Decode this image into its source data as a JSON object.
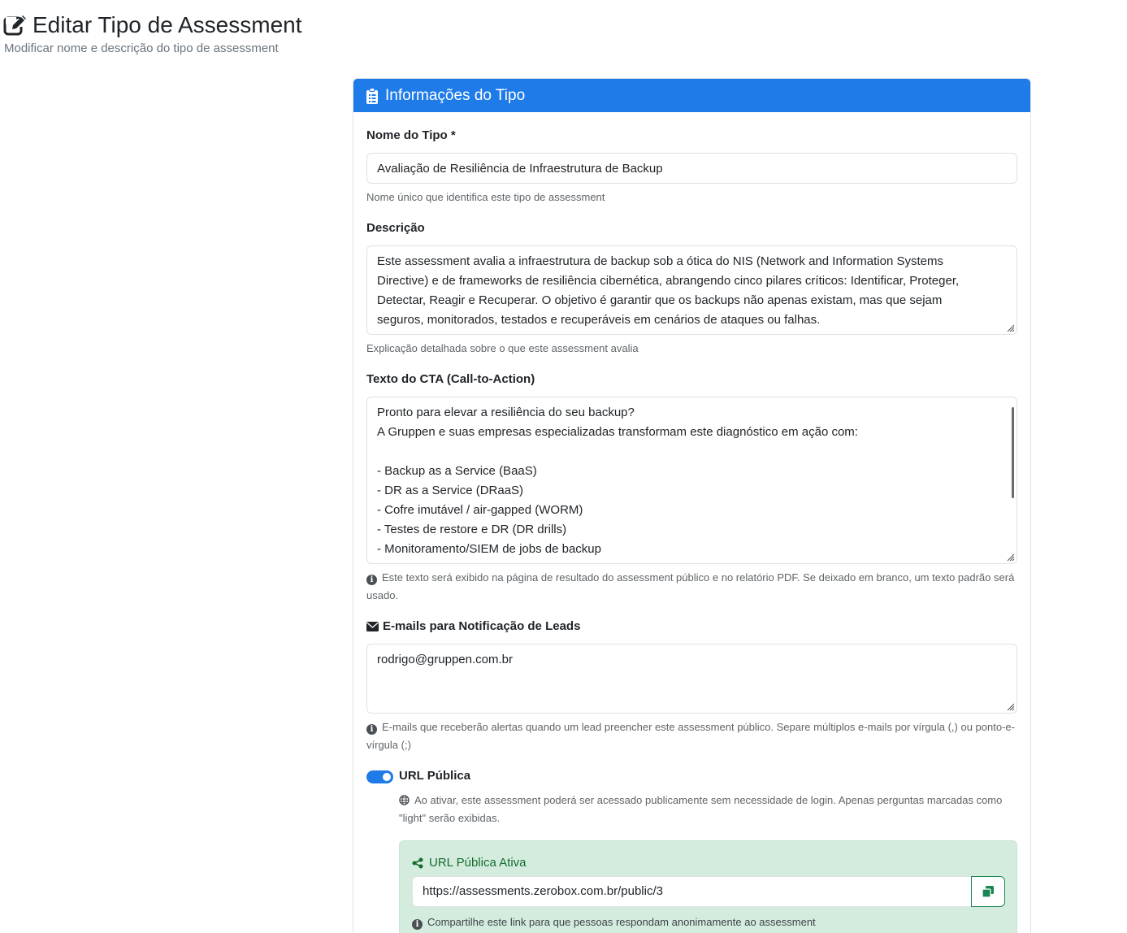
{
  "page": {
    "title": "Editar Tipo de Assessment",
    "subtitle": "Modificar nome e descrição do tipo de assessment",
    "title_icon": "edit-icon"
  },
  "card": {
    "header": "Informações do Tipo",
    "header_icon": "clipboard-icon",
    "header_color": "#1e7be8"
  },
  "form": {
    "name": {
      "label": "Nome do Tipo *",
      "value": "Avaliação de Resiliência de Infraestrutura de Backup",
      "help": "Nome único que identifica este tipo de assessment"
    },
    "description": {
      "label": "Descrição",
      "value": "Este assessment avalia a infraestrutura de backup sob a ótica do NIS (Network and Information Systems\nDirective) e de frameworks de resiliência cibernética, abrangendo cinco pilares críticos: Identificar, Proteger,\nDetectar, Reagir e Recuperar. O objetivo é garantir que os backups não apenas existam, mas que sejam\nseguros, monitorados, testados e recuperáveis em cenários de ataques ou falhas.",
      "help": "Explicação detalhada sobre o que este assessment avalia"
    },
    "cta": {
      "label": "Texto do CTA (Call-to-Action)",
      "value": "Pronto para elevar a resiliência do seu backup?\nA Gruppen e suas empresas especializadas transformam este diagnóstico em ação com:\n\n- Backup as a Service (BaaS)\n- DR as a Service (DRaaS)\n- Cofre imutável / air-gapped (WORM)\n- Testes de restore e DR (DR drills)\n- Monitoramento/SIEM de jobs de backup",
      "help": "Este texto será exibido na página de resultado do assessment público e no relatório PDF. Se deixado em branco, um texto padrão será usado."
    },
    "emails": {
      "label": "E-mails para Notificação de Leads",
      "label_icon": "envelope-icon",
      "value": "rodrigo@gruppen.com.br",
      "help": "E-mails que receberão alertas quando um lead preencher este assessment público. Separe múltiplos e-mails por vírgula (,) ou ponto-e-vírgula (;)"
    },
    "public_url": {
      "label": "URL Pública",
      "enabled": true,
      "help": "Ao ativar, este assessment poderá ser acessado publicamente sem necessidade de login. Apenas perguntas marcadas como \"light\" serão exibidas.",
      "help_icon": "globe-icon",
      "active_title": "URL Pública Ativa",
      "active_icon": "share-icon",
      "url": "https://assessments.zerobox.com.br/public/3",
      "copy_icon": "copy-icon",
      "share_help": "Compartilhe este link para que pessoas respondam anonimamente ao assessment"
    }
  }
}
